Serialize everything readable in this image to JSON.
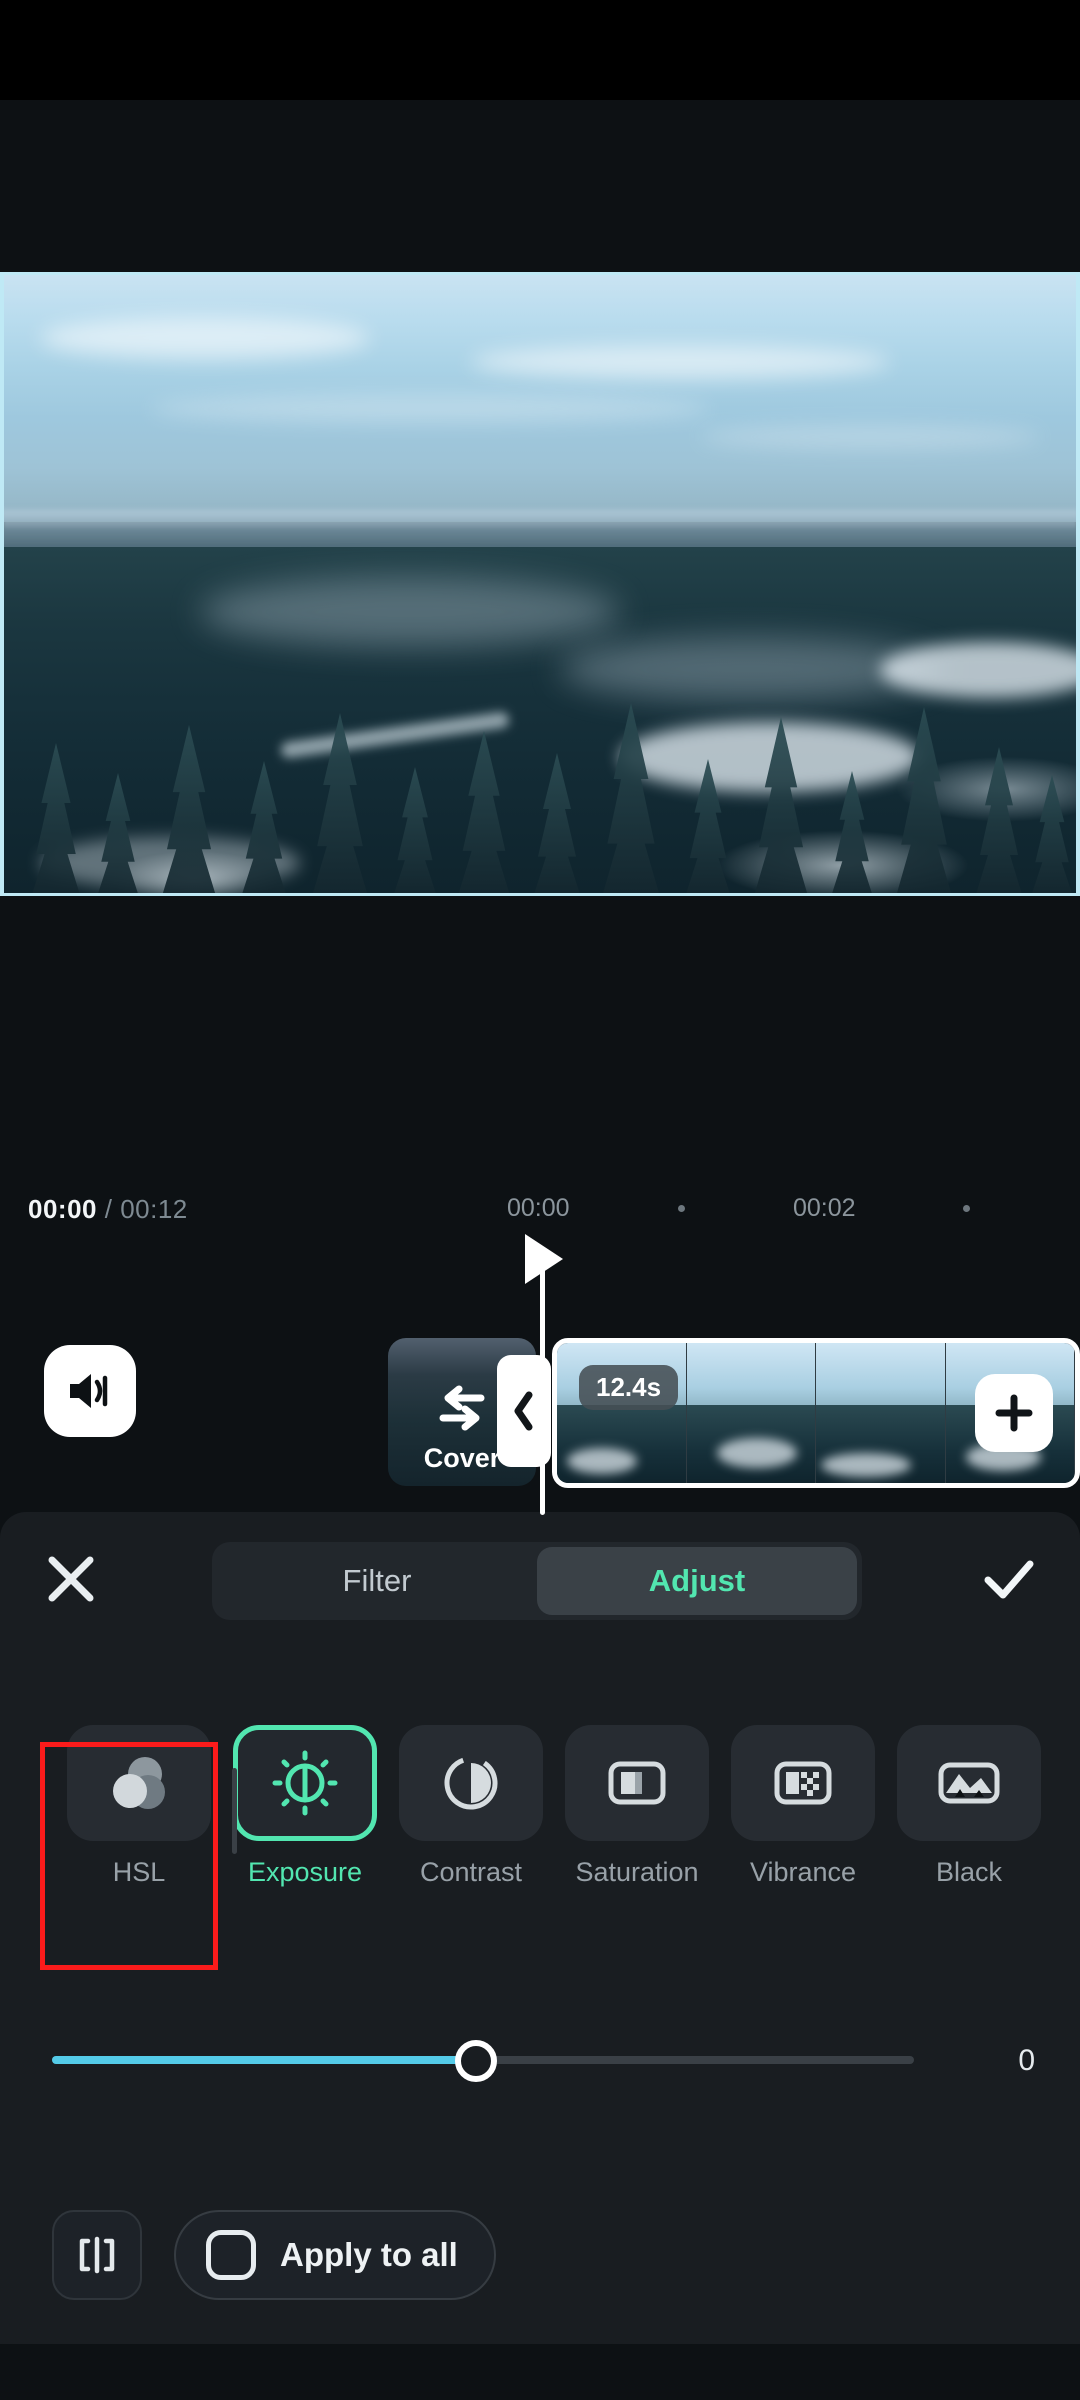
{
  "app": {
    "name": "video-editor",
    "theme_bg": "#0d1114",
    "accent": "#52e6b0",
    "slider_color": "#54cbe8",
    "highlight_color": "#fb1b1b"
  },
  "preview": {
    "play_icon": "play-icon",
    "description": "aerial view of snowy evergreen forest under pale blue sky"
  },
  "timeline": {
    "current_time": "00:00",
    "separator": "/",
    "total_time": "00:12",
    "ruler_ticks": [
      {
        "label": "00:00",
        "type": "label"
      },
      {
        "label": "",
        "type": "dot"
      },
      {
        "label": "00:02",
        "type": "label"
      },
      {
        "label": "",
        "type": "dot"
      }
    ],
    "volume_icon": "volume-icon",
    "cover": {
      "label": "Cover",
      "icon": "swap-transition-icon"
    },
    "transition_handle_icon": "chevron-left-icon",
    "clip": {
      "duration": "12.4s"
    },
    "add_clip_icon": "plus-icon"
  },
  "panel": {
    "close_icon": "close-icon",
    "confirm_icon": "check-icon",
    "tabs": [
      {
        "label": "Filter",
        "active": false
      },
      {
        "label": "Adjust",
        "active": true
      }
    ]
  },
  "adjust": {
    "tools": [
      {
        "label": "HSL",
        "icon": "hsl-circles-icon",
        "selected": false,
        "highlighted": true
      },
      {
        "label": "Exposure",
        "icon": "exposure-sun-icon",
        "selected": true,
        "highlighted": false
      },
      {
        "label": "Contrast",
        "icon": "contrast-circle-icon",
        "selected": false,
        "highlighted": false
      },
      {
        "label": "Saturation",
        "icon": "saturation-icon",
        "selected": false,
        "highlighted": false
      },
      {
        "label": "Vibrance",
        "icon": "vibrance-icon",
        "selected": false,
        "highlighted": false
      },
      {
        "label": "Black",
        "icon": "black-point-icon",
        "selected": false,
        "highlighted": false
      }
    ],
    "slider": {
      "value": "0",
      "min": -100,
      "max": 100,
      "fill_percent": 50
    }
  },
  "bottom": {
    "reset_icon": "reset-adjust-icon",
    "apply_to_all": {
      "label": "Apply to all",
      "checked": false
    }
  }
}
